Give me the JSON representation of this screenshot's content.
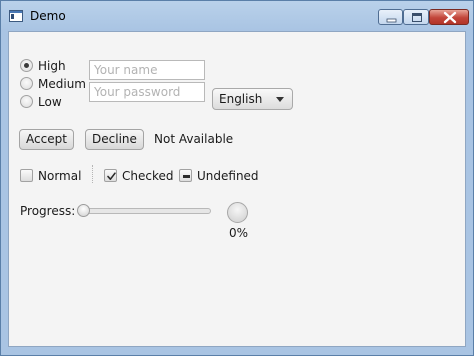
{
  "window": {
    "title": "Demo"
  },
  "priority": {
    "options": [
      {
        "label": "High",
        "selected": true
      },
      {
        "label": "Medium",
        "selected": false
      },
      {
        "label": "Low",
        "selected": false
      }
    ]
  },
  "form": {
    "name_placeholder": "Your name",
    "password_placeholder": "Your password",
    "language_value": "English"
  },
  "actions": {
    "accept_label": "Accept",
    "decline_label": "Decline",
    "status_text": "Not Available"
  },
  "checkboxes": [
    {
      "label": "Normal",
      "state": "unchecked"
    },
    {
      "label": "Checked",
      "state": "checked"
    },
    {
      "label": "Undefined",
      "state": "indeterminate"
    }
  ],
  "progress": {
    "label": "Progress:",
    "slider_value": 0,
    "percent_text": "0%"
  }
}
